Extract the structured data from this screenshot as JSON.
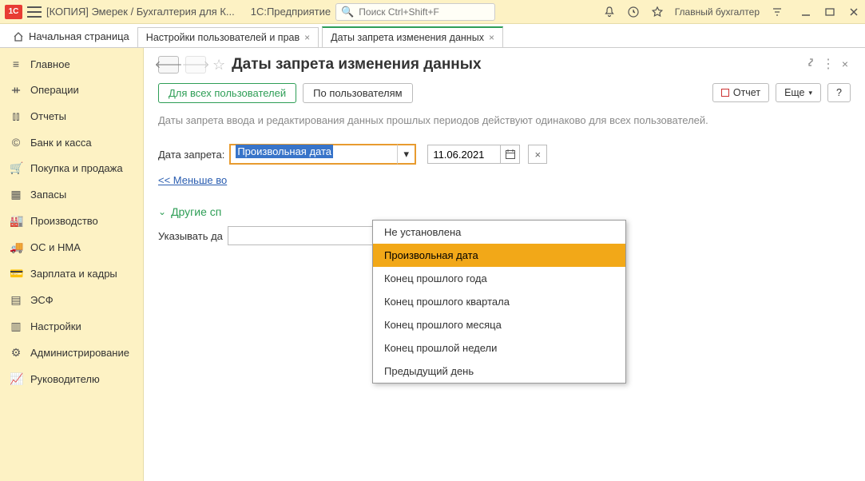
{
  "titlebar": {
    "logo_text": "1C",
    "title1": "[КОПИЯ] Эмерек / Бухгалтерия для К...",
    "title2": "1С:Предприятие",
    "search_placeholder": "Поиск Ctrl+Shift+F",
    "user": "Главный бухгалтер"
  },
  "tabs": {
    "home": "Начальная страница",
    "t1": "Настройки пользователей и прав",
    "t2": "Даты запрета изменения данных"
  },
  "sidebar": [
    {
      "icon": "≡",
      "label": "Главное"
    },
    {
      "icon": "ᚑ",
      "label": "Операции"
    },
    {
      "icon": "⫾⫾",
      "label": "Отчеты"
    },
    {
      "icon": "©",
      "label": "Банк и касса"
    },
    {
      "icon": "🛒",
      "label": "Покупка и продажа"
    },
    {
      "icon": "▦",
      "label": "Запасы"
    },
    {
      "icon": "🏭",
      "label": "Производство"
    },
    {
      "icon": "🚚",
      "label": "ОС и НМА"
    },
    {
      "icon": "💳",
      "label": "Зарплата и кадры"
    },
    {
      "icon": "▤",
      "label": "ЭСФ"
    },
    {
      "icon": "▥",
      "label": "Настройки"
    },
    {
      "icon": "⚙",
      "label": "Администрирование"
    },
    {
      "icon": "📈",
      "label": "Руководителю"
    }
  ],
  "page": {
    "title": "Даты запрета изменения данных",
    "filter1": "Для всех пользователей",
    "filter2": "По пользователям",
    "report_btn": "Отчет",
    "more_btn": "Еще",
    "help_btn": "?",
    "desc": "Даты запрета ввода и редактирования данных прошлых периодов действуют одинаково для всех пользователей.",
    "date_label": "Дата запрета:",
    "combo_value": "Произвольная дата",
    "date_value": "11.06.2021",
    "less_link": "<< Меньше во",
    "section": "Другие сп",
    "hint": "Указывать да"
  },
  "dropdown": {
    "items": [
      "Не установлена",
      "Произвольная дата",
      "Конец прошлого года",
      "Конец прошлого квартала",
      "Конец прошлого месяца",
      "Конец прошлой недели",
      "Предыдущий день"
    ],
    "selected_index": 1
  }
}
